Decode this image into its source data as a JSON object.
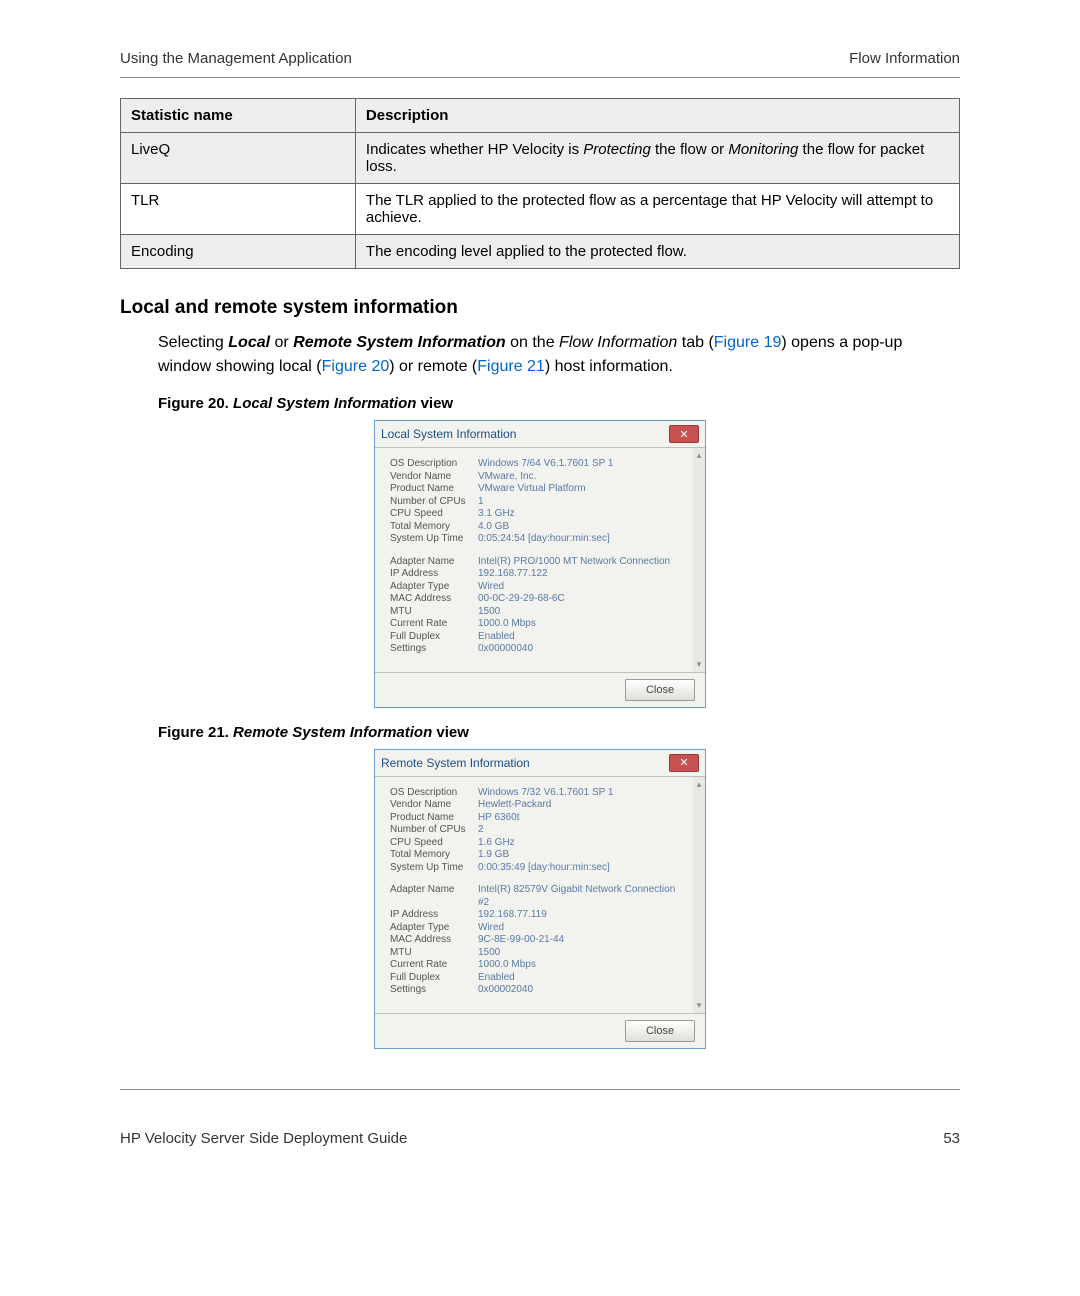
{
  "header": {
    "left": "Using the Management Application",
    "right": "Flow Information"
  },
  "table": {
    "head": {
      "c1": "Statistic name",
      "c2": "Description"
    },
    "rows": [
      {
        "c1": "LiveQ",
        "c2_pre": "Indicates whether HP Velocity is ",
        "it1": "Protecting",
        "mid": " the flow or ",
        "it2": "Monitoring",
        "post": " the flow for packet loss.",
        "shade": true
      },
      {
        "c1": "TLR",
        "c2": "The TLR applied to the protected flow as a percentage that HP Velocity will attempt to achieve.",
        "shade": false
      },
      {
        "c1": "Encoding",
        "c2": "The encoding level applied to the protected flow.",
        "shade": true
      }
    ]
  },
  "section": {
    "heading": "Local and remote system information",
    "p1_a": "Selecting ",
    "p1_b": "Local",
    "p1_c": " or ",
    "p1_d": "Remote System Information",
    "p1_e": " on the ",
    "p1_f": "Flow Information",
    "p1_g": " tab (",
    "p1_link1": "Figure 19",
    "p1_h": ") opens a pop-up window showing local (",
    "p1_link2": "Figure 20",
    "p1_i": ") or remote (",
    "p1_link3": "Figure 21",
    "p1_j": ") host information."
  },
  "fig20": {
    "cap_pre": "Figure 20.  ",
    "cap_it": "Local System Information",
    "cap_post": " view",
    "title": "Local System Information",
    "close_btn": "Close",
    "top": [
      {
        "l": "OS Description",
        "v": "Windows 7/64  V6.1.7601 SP 1"
      },
      {
        "l": "Vendor Name",
        "v": "VMware, Inc."
      },
      {
        "l": "Product Name",
        "v": "VMware Virtual Platform"
      },
      {
        "l": "Number of CPUs",
        "v": "1"
      },
      {
        "l": "CPU Speed",
        "v": "3.1 GHz"
      },
      {
        "l": "Total Memory",
        "v": "4.0 GB"
      },
      {
        "l": "System Up Time",
        "v": "0:05:24:54  [day:hour:min:sec]"
      }
    ],
    "bottom": [
      {
        "l": "Adapter Name",
        "v": "Intel(R) PRO/1000 MT Network Connection"
      },
      {
        "l": "IP Address",
        "v": "192.168.77.122"
      },
      {
        "l": "Adapter Type",
        "v": "Wired"
      },
      {
        "l": "MAC Address",
        "v": "00-0C-29-29-68-6C"
      },
      {
        "l": "MTU",
        "v": "1500"
      },
      {
        "l": "Current Rate",
        "v": "1000.0 Mbps"
      },
      {
        "l": "Full Duplex",
        "v": "Enabled"
      },
      {
        "l": "Settings",
        "v": "0x00000040"
      }
    ]
  },
  "fig21": {
    "cap_pre": "Figure 21.  ",
    "cap_it": "Remote System Information",
    "cap_post": " view",
    "title": "Remote System Information",
    "close_btn": "Close",
    "top": [
      {
        "l": "OS Description",
        "v": "Windows 7/32  V6.1.7601 SP 1"
      },
      {
        "l": "Vendor Name",
        "v": "Hewlett-Packard"
      },
      {
        "l": "Product Name",
        "v": "HP 6360t"
      },
      {
        "l": "Number of CPUs",
        "v": "2"
      },
      {
        "l": "CPU Speed",
        "v": "1.6 GHz"
      },
      {
        "l": "Total Memory",
        "v": "1.9 GB"
      },
      {
        "l": "System Up Time",
        "v": "0:00:35:49  [day:hour:min:sec]"
      }
    ],
    "bottom": [
      {
        "l": "Adapter Name",
        "v": "Intel(R) 82579V Gigabit Network Connection #2"
      },
      {
        "l": "IP Address",
        "v": "192.168.77.119"
      },
      {
        "l": "Adapter Type",
        "v": "Wired"
      },
      {
        "l": "MAC Address",
        "v": "9C-8E-99-00-21-44"
      },
      {
        "l": "MTU",
        "v": "1500"
      },
      {
        "l": "Current Rate",
        "v": "1000.0 Mbps"
      },
      {
        "l": "Full Duplex",
        "v": "Enabled"
      },
      {
        "l": "Settings",
        "v": "0x00002040"
      }
    ]
  },
  "footer": {
    "left": "HP Velocity Server Side Deployment Guide",
    "right": "53"
  }
}
